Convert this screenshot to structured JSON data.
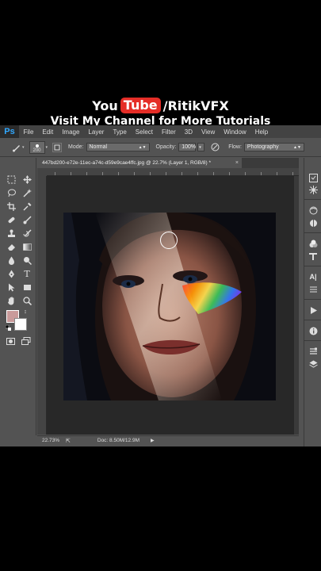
{
  "banner": {
    "you": "You",
    "tube": "Tube",
    "handle": "/RitikVFX",
    "tagline": "Visit My Channel for More Tutorials"
  },
  "app": {
    "logo": "Ps",
    "menu": [
      "File",
      "Edit",
      "Image",
      "Layer",
      "Type",
      "Select",
      "Filter",
      "3D",
      "View",
      "Window",
      "Help"
    ]
  },
  "options": {
    "brush_size": "200",
    "mode_label": "Mode:",
    "mode_value": "Normal",
    "opacity_label": "Opacity:",
    "opacity_value": "100%",
    "flow_label": "Flow:",
    "flow_value": "Photography"
  },
  "document": {
    "tab_title": "447bd200-e72e-11ec-a74c-d59e9cae4ffc.jpg @ 22.7% (Layer 1, RGB/8) *"
  },
  "status": {
    "zoom": "22.73%",
    "doc": "Doc: 8.50M/12.9M"
  },
  "colors": {
    "foreground": "#c99a9a",
    "background": "#ffffff",
    "accent": "#31a8ff",
    "youtube_red": "#e52d27"
  },
  "tools": [
    "move-icon",
    "marquee-icon",
    "lasso-icon",
    "magic-wand-icon",
    "crop-icon",
    "eyedropper-icon",
    "healing-brush-icon",
    "brush-icon",
    "clone-stamp-icon",
    "history-brush-icon",
    "eraser-icon",
    "gradient-icon",
    "blur-icon",
    "dodge-icon",
    "pen-icon",
    "type-icon",
    "path-selection-icon",
    "rectangle-icon",
    "hand-icon",
    "zoom-icon"
  ],
  "panels": [
    "history-icon",
    "properties-icon",
    "color-icon",
    "swatches-icon",
    "adjustments-icon",
    "styles-icon",
    "character-icon",
    "paragraph-icon",
    "actions-icon",
    "info-icon",
    "channels-icon",
    "layers-icon"
  ]
}
